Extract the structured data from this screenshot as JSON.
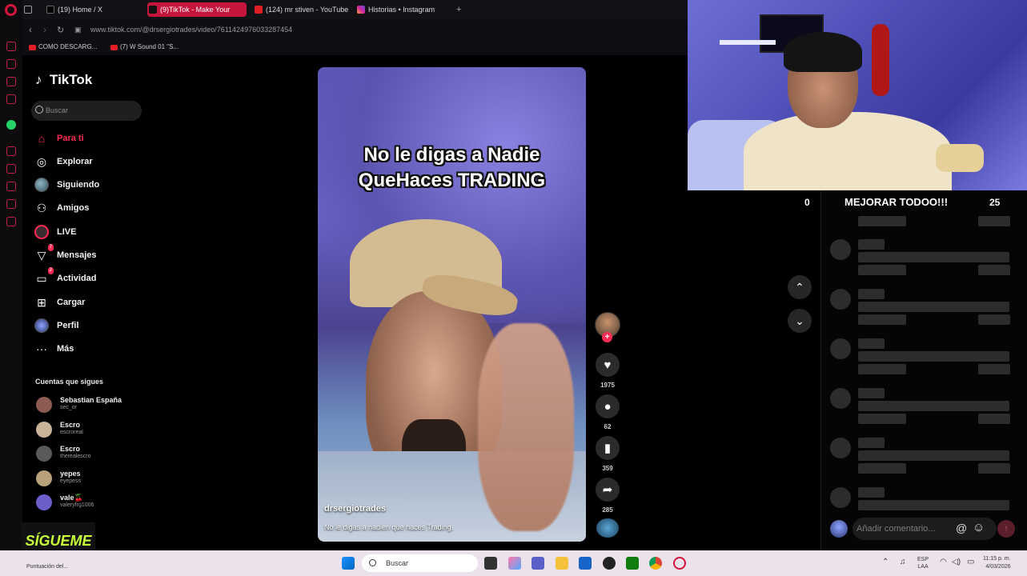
{
  "browser": {
    "tabs": [
      {
        "label": "(19) Home / X",
        "icon": "x-icon",
        "active": false
      },
      {
        "label": "(9)TikTok - Make Your",
        "icon": "tiktok-icon",
        "active": true
      },
      {
        "label": "(124) mr stiven - YouTube",
        "icon": "youtube-icon",
        "active": false
      },
      {
        "label": "Historias • Instagram",
        "icon": "instagram-icon",
        "active": false
      }
    ],
    "new_tab": "+",
    "url": "www.tiktok.com/@drsergiotrades/video/7611424976033287454",
    "bookmarks": [
      "COMO DESCARG...",
      "(7) W Sound 01 \"S..."
    ]
  },
  "tiktok": {
    "logo": "TikTok",
    "search_placeholder": "Buscar",
    "nav": [
      {
        "label": "Para ti",
        "icon": "home-icon",
        "active": true,
        "badge": ""
      },
      {
        "label": "Explorar",
        "icon": "compass-icon",
        "active": false,
        "badge": ""
      },
      {
        "label": "Siguiendo",
        "icon": "following-avatar-icon",
        "active": false,
        "badge": ""
      },
      {
        "label": "Amigos",
        "icon": "friends-icon",
        "active": false,
        "badge": ""
      },
      {
        "label": "LIVE",
        "icon": "live-icon",
        "active": false,
        "badge": ""
      },
      {
        "label": "Mensajes",
        "icon": "send-icon",
        "active": false,
        "badge": "7"
      },
      {
        "label": "Actividad",
        "icon": "activity-icon",
        "active": false,
        "badge": "2"
      },
      {
        "label": "Cargar",
        "icon": "upload-icon",
        "active": false,
        "badge": ""
      },
      {
        "label": "Perfil",
        "icon": "profile-avatar-icon",
        "active": false,
        "badge": ""
      },
      {
        "label": "Más",
        "icon": "more-icon",
        "active": false,
        "badge": ""
      }
    ],
    "following_title": "Cuentas que sigues",
    "following": [
      {
        "name": "Sebastian España",
        "user": "sec_or",
        "color": "#8c5b52"
      },
      {
        "name": "Escro",
        "user": "escroreal",
        "color": "#c9b49a"
      },
      {
        "name": "Escro",
        "user": "therealescro",
        "color": "#5a5a5a"
      },
      {
        "name": "yepes",
        "user": "eyepess",
        "color": "#b9a27a"
      },
      {
        "name": "vale🍒",
        "user": "valeryfrg1006",
        "color": "#6c5fc9"
      }
    ]
  },
  "video": {
    "caption_line1": "No le digas a Nadie",
    "caption_line2": "QueHaces TRADING",
    "author": "drsergiotrades",
    "description": "No le digas a nadien que haces Trading."
  },
  "actions": {
    "likes": "1975",
    "comments": "62",
    "saves": "359",
    "shares": "285"
  },
  "overlay": {
    "score_left": "0",
    "banner": "MEJORAR TODOO!!!",
    "score_right": "25",
    "watermark": "SÍGUEME"
  },
  "comments": {
    "placeholder": "Añadir comentario...",
    "at_symbol": "@"
  },
  "taskbar": {
    "search": "Buscar",
    "punt": "Puntuación del...",
    "lang_1": "ESP",
    "lang_2": "LAA",
    "time": "11:15 p. m.",
    "date": "4/03/2026"
  }
}
